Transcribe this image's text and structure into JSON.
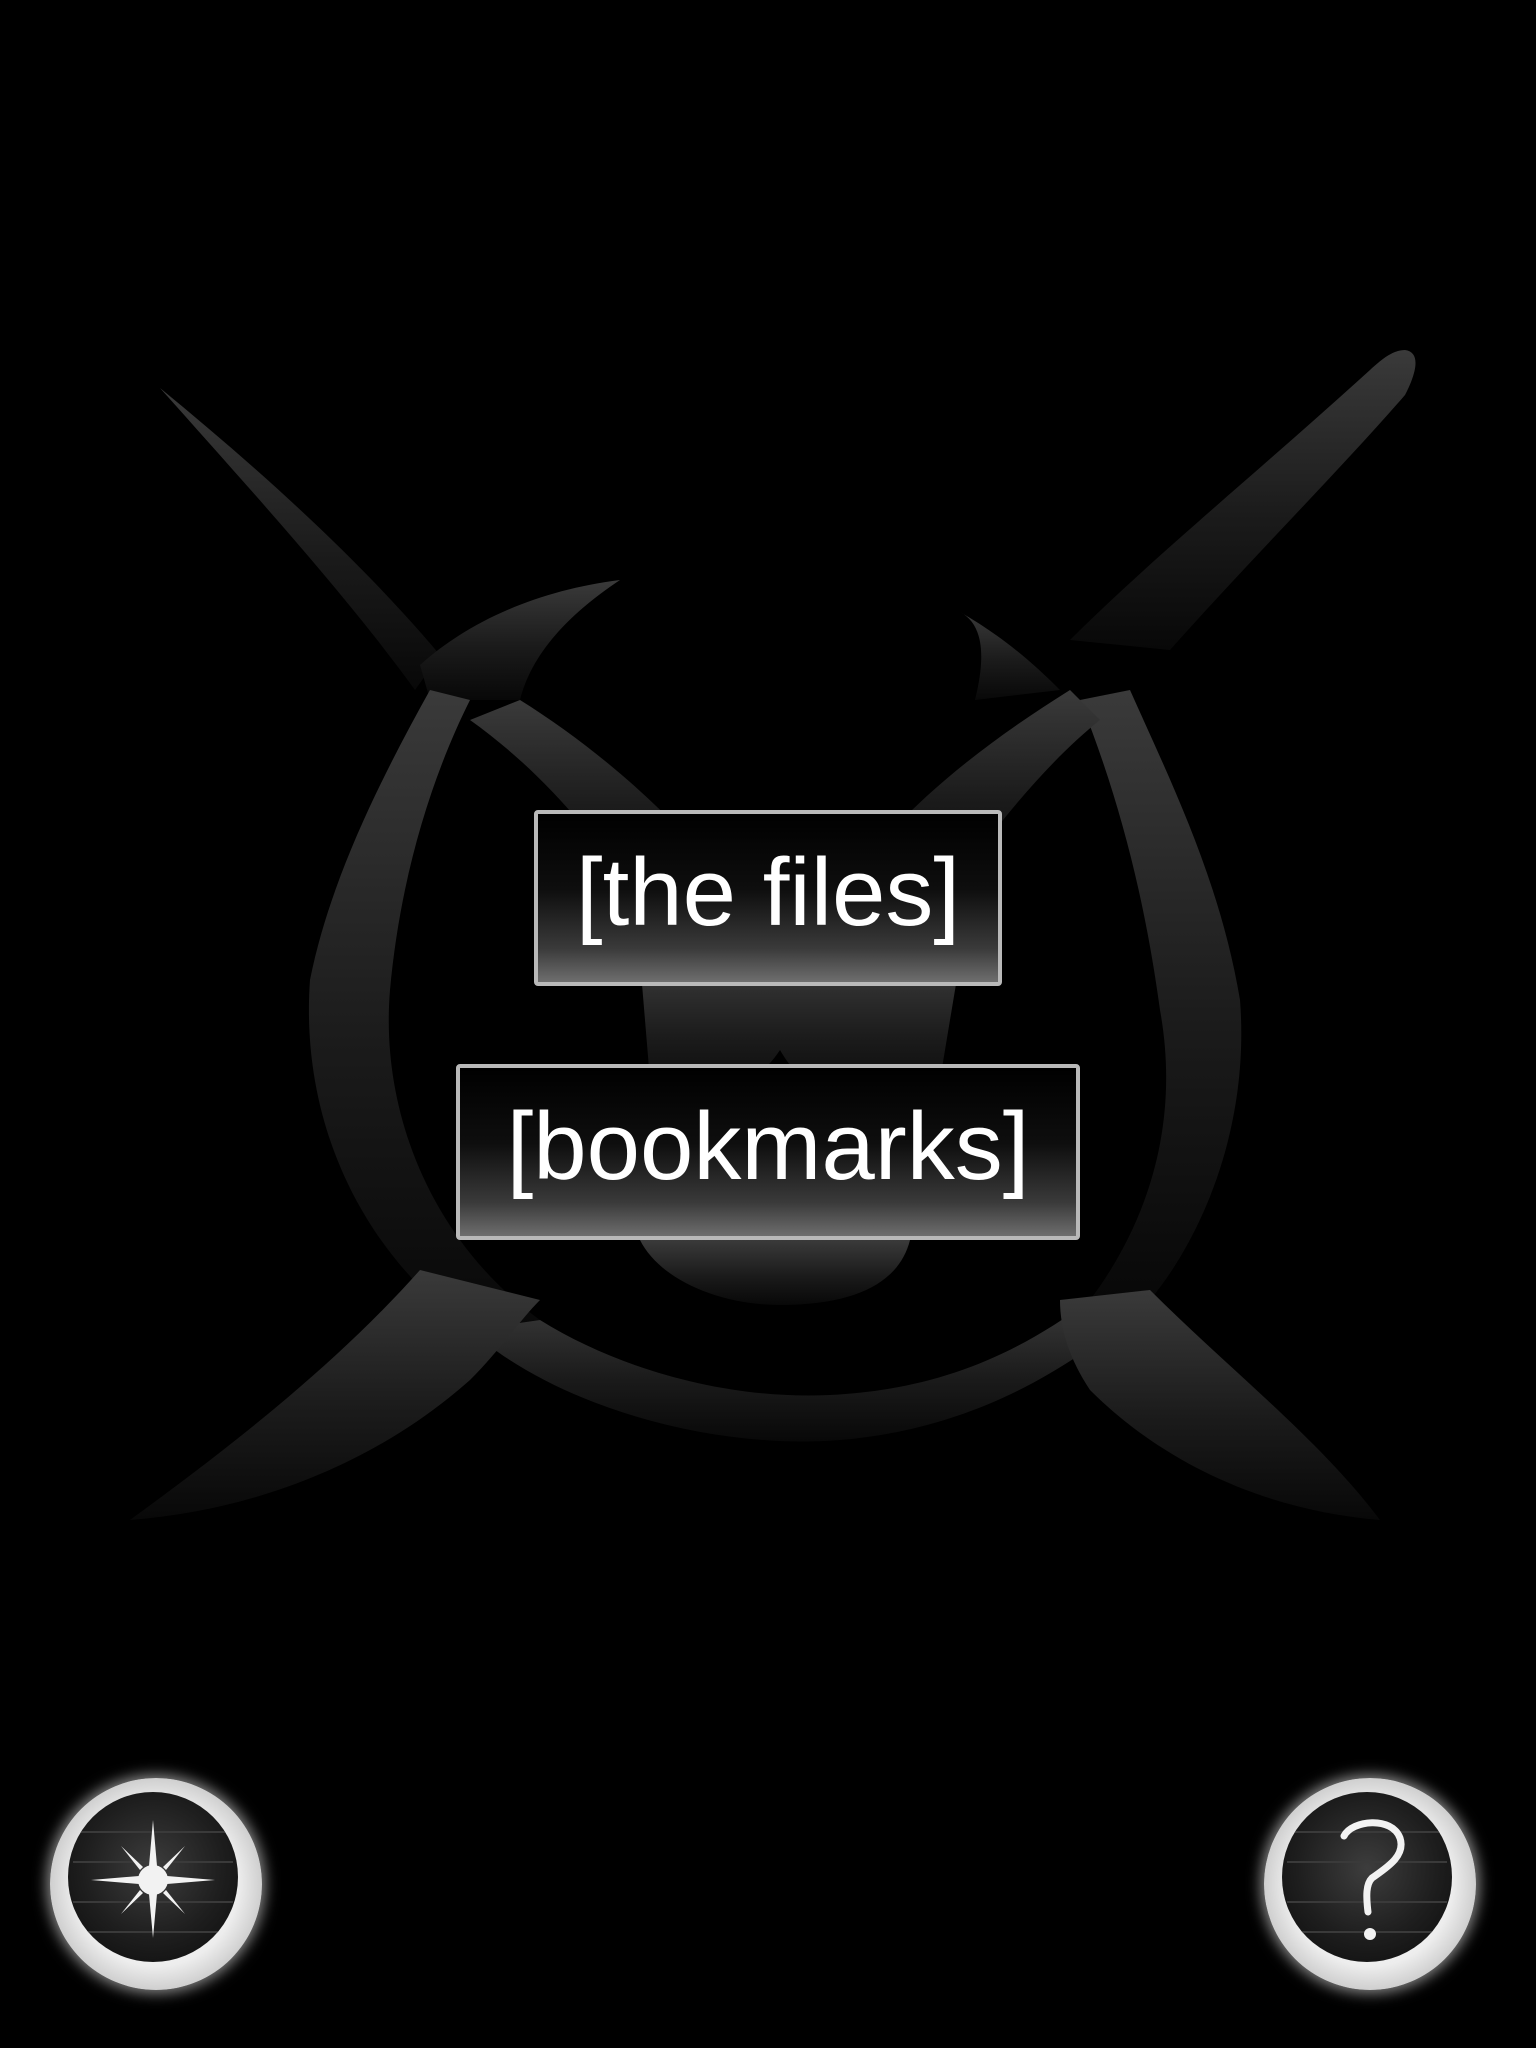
{
  "screen": {
    "background_color": "#000000",
    "emblem": "x-and-circle-emblem"
  },
  "menu": {
    "files_label": "[the files]",
    "bookmarks_label": "[bookmarks]",
    "button_border_color": "#b9b9b9",
    "text_color": "#ffffff"
  },
  "corner_buttons": {
    "settings_icon": "sun-icon",
    "help_icon": "question-mark-icon"
  }
}
